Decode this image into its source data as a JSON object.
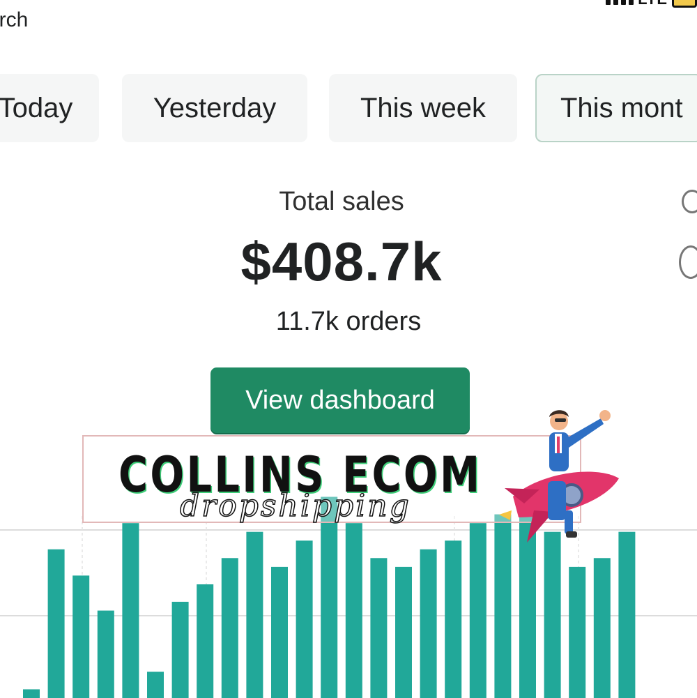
{
  "header": {
    "search_text": "arch"
  },
  "status_bar": {
    "network": "LTE"
  },
  "tabs": [
    {
      "label": "Today"
    },
    {
      "label": "Yesterday"
    },
    {
      "label": "This week"
    },
    {
      "label": "This mont"
    }
  ],
  "summary": {
    "title": "Total sales",
    "value": "$408.7k",
    "orders": "11.7k orders"
  },
  "button": {
    "label": "View dashboard"
  },
  "overlay": {
    "brand": "COLLINS ECOM",
    "subtitle": "dropshipping"
  },
  "colors": {
    "accent": "#1f8a63",
    "bar": "#21a899"
  },
  "chart_data": {
    "type": "bar",
    "values": [
      1,
      17,
      14,
      10,
      20,
      3,
      11,
      13,
      16,
      19,
      15,
      18,
      23,
      20,
      16,
      15,
      17,
      18,
      20,
      21,
      23,
      19,
      15,
      16,
      19
    ],
    "ylim": [
      0,
      24
    ],
    "grid": true
  }
}
